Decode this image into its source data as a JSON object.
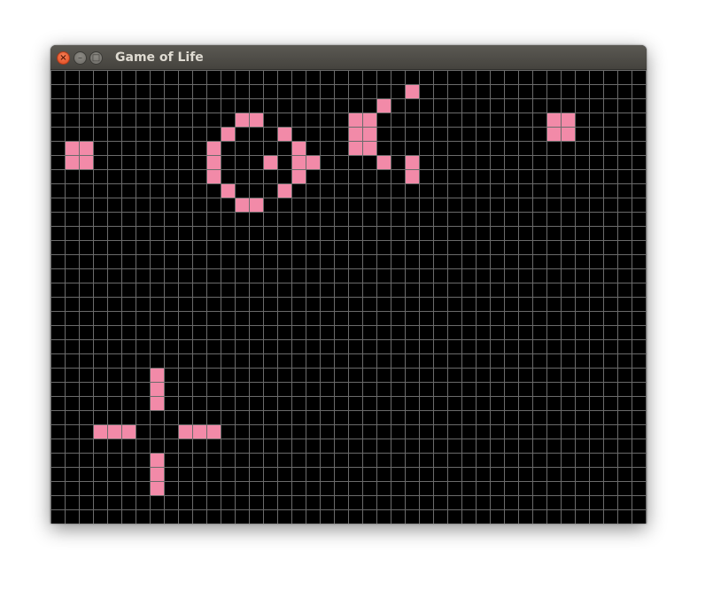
{
  "window": {
    "title": "Game of Life",
    "buttons": {
      "close_icon": "×",
      "minimize_icon": "–",
      "maximize_icon": "□"
    }
  },
  "board": {
    "columns": 42,
    "rows": 32,
    "live_cell_color": "#f28aa8",
    "grid_line_color": "#6b6b6b",
    "background_color": "#000000",
    "live_cells": [
      [
        1,
        5
      ],
      [
        2,
        5
      ],
      [
        1,
        6
      ],
      [
        2,
        6
      ],
      [
        13,
        3
      ],
      [
        14,
        3
      ],
      [
        12,
        4
      ],
      [
        16,
        4
      ],
      [
        11,
        5
      ],
      [
        17,
        5
      ],
      [
        11,
        6
      ],
      [
        15,
        6
      ],
      [
        17,
        6
      ],
      [
        18,
        6
      ],
      [
        11,
        7
      ],
      [
        17,
        7
      ],
      [
        12,
        8
      ],
      [
        16,
        8
      ],
      [
        13,
        9
      ],
      [
        14,
        9
      ],
      [
        25,
        1
      ],
      [
        23,
        2
      ],
      [
        21,
        3
      ],
      [
        22,
        3
      ],
      [
        21,
        4
      ],
      [
        22,
        4
      ],
      [
        21,
        5
      ],
      [
        22,
        5
      ],
      [
        23,
        6
      ],
      [
        25,
        6
      ],
      [
        25,
        7
      ],
      [
        35,
        3
      ],
      [
        36,
        3
      ],
      [
        35,
        4
      ],
      [
        36,
        4
      ],
      [
        7,
        21
      ],
      [
        7,
        22
      ],
      [
        7,
        23
      ],
      [
        3,
        25
      ],
      [
        4,
        25
      ],
      [
        5,
        25
      ],
      [
        9,
        25
      ],
      [
        10,
        25
      ],
      [
        11,
        25
      ],
      [
        7,
        27
      ],
      [
        7,
        28
      ],
      [
        7,
        29
      ]
    ]
  }
}
